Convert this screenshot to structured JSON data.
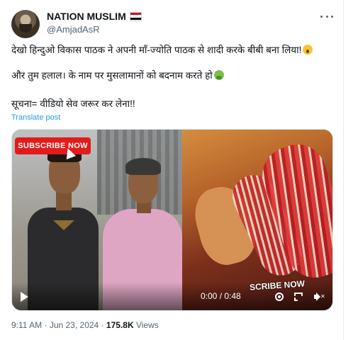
{
  "author": {
    "display_name": "NATION MUSLIM",
    "handle": "@AmjadAsR",
    "flag_colors": [
      "#ce1126",
      "#ffffff",
      "#000000"
    ]
  },
  "tweet": {
    "line1": "देखो हिन्दुओ विकास पाठक ने अपनी माँ-ज्योति पाठक से शादी करके बीबी बना लिया!",
    "line2": "और तुम हलाल। के नाम पर मुसलामानों को बदनाम करते हो",
    "line3": "सूचना= वीडियो सेव जरूर कर लेना!!",
    "translate": "Translate post"
  },
  "media": {
    "subscribe_badge": "SUBSCRIBE NOW",
    "subscribe_overlay": "SCRIBE NOW",
    "time": "0:00 / 0:48"
  },
  "meta": {
    "time": "9:11 AM",
    "date": "Jun 23, 2024",
    "views_count": "175.8K",
    "views_label": "Views",
    "separator": "·"
  },
  "icons": {
    "more": "more-horizontal-icon",
    "play": "play-icon",
    "settings": "settings-icon",
    "fullscreen": "fullscreen-icon",
    "volume": "volume-muted-icon"
  }
}
